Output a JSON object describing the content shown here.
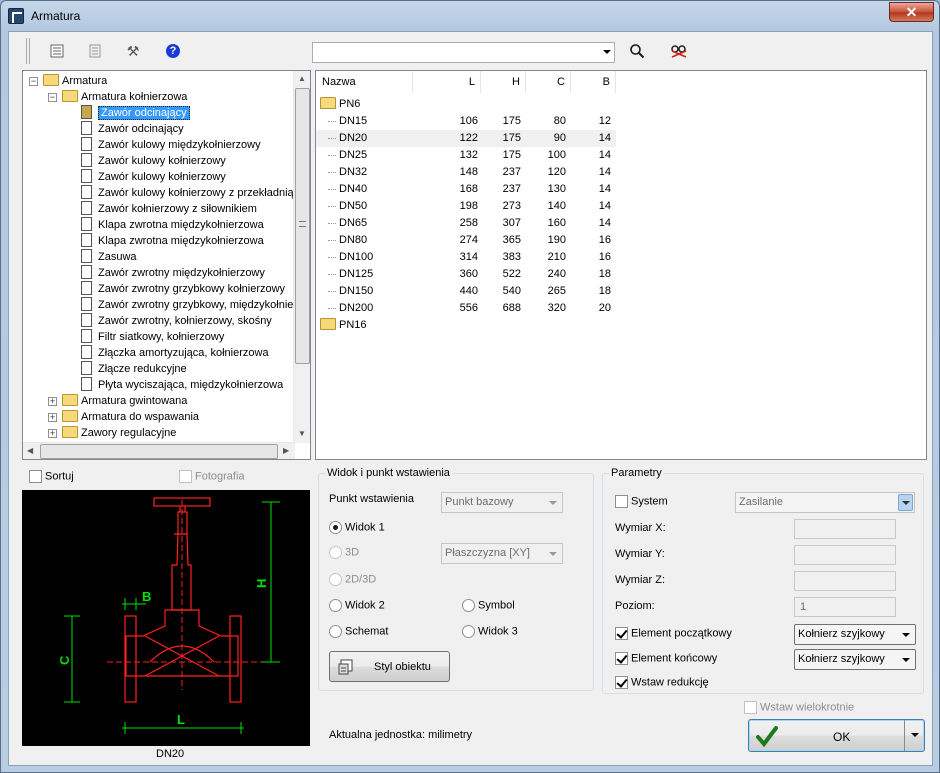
{
  "window": {
    "title": "Armatura"
  },
  "toolbar": {
    "search_value": "",
    "buttons": [
      "list-icon",
      "properties-icon",
      "tools-icon",
      "help-icon",
      "search-icon",
      "find-object-icon"
    ]
  },
  "tree": {
    "items": [
      {
        "level": 0,
        "type": "folder",
        "expander": "−",
        "label": "Armatura"
      },
      {
        "level": 1,
        "type": "folder",
        "expander": "−",
        "label": "Armatura kołnierzowa"
      },
      {
        "level": 2,
        "type": "doc",
        "label": "Zawór odcinający",
        "selected": true
      },
      {
        "level": 2,
        "type": "doc",
        "label": "Zawór odcinający"
      },
      {
        "level": 2,
        "type": "doc",
        "label": "Zawór kulowy międzykołnierzowy"
      },
      {
        "level": 2,
        "type": "doc",
        "label": "Zawór kulowy kołnierzowy"
      },
      {
        "level": 2,
        "type": "doc",
        "label": "Zawór kulowy kołnierzowy"
      },
      {
        "level": 2,
        "type": "doc",
        "label": "Zawór kulowy kołnierzowy z przekładnią"
      },
      {
        "level": 2,
        "type": "doc",
        "label": "Zawór kołnierzowy z siłownikiem"
      },
      {
        "level": 2,
        "type": "doc",
        "label": "Klapa zwrotna międzykołnierzowa"
      },
      {
        "level": 2,
        "type": "doc",
        "label": "Klapa zwrotna międzykołnierzowa"
      },
      {
        "level": 2,
        "type": "doc",
        "label": "Zasuwa"
      },
      {
        "level": 2,
        "type": "doc",
        "label": "Zawór zwrotny międzykołnierzowy"
      },
      {
        "level": 2,
        "type": "doc",
        "label": "Zawór zwrotny grzybkowy kołnierzowy"
      },
      {
        "level": 2,
        "type": "doc",
        "label": "Zawór zwrotny grzybkowy, międzykołnierzowy"
      },
      {
        "level": 2,
        "type": "doc",
        "label": "Zawór zwrotny, kołnierzowy, skośny"
      },
      {
        "level": 2,
        "type": "doc",
        "label": "Filtr siatkowy, kołnierzowy"
      },
      {
        "level": 2,
        "type": "doc",
        "label": "Złączka amortyzująca, kołnierzowa"
      },
      {
        "level": 2,
        "type": "doc",
        "label": "Złącze redukcyjne"
      },
      {
        "level": 2,
        "type": "doc",
        "label": "Płyta wyciszająca, międzykołnierzowa"
      },
      {
        "level": 1,
        "type": "folder",
        "expander": "+",
        "label": "Armatura gwintowana"
      },
      {
        "level": 1,
        "type": "folder",
        "expander": "+",
        "label": "Armatura do wspawania"
      },
      {
        "level": 1,
        "type": "folder",
        "expander": "+",
        "label": "Zawory regulacyjne"
      }
    ]
  },
  "table": {
    "headers": [
      "Nazwa",
      "L",
      "H",
      "C",
      "B"
    ],
    "groups": [
      {
        "name": "PN6",
        "rows": [
          [
            "DN15",
            "106",
            "175",
            "80",
            "12"
          ],
          [
            "DN20",
            "122",
            "175",
            "90",
            "14"
          ],
          [
            "DN25",
            "132",
            "175",
            "100",
            "14"
          ],
          [
            "DN32",
            "148",
            "237",
            "120",
            "14"
          ],
          [
            "DN40",
            "168",
            "237",
            "130",
            "14"
          ],
          [
            "DN50",
            "198",
            "273",
            "140",
            "14"
          ],
          [
            "DN65",
            "258",
            "307",
            "160",
            "14"
          ],
          [
            "DN80",
            "274",
            "365",
            "190",
            "16"
          ],
          [
            "DN100",
            "314",
            "383",
            "210",
            "16"
          ],
          [
            "DN125",
            "360",
            "522",
            "240",
            "18"
          ],
          [
            "DN150",
            "440",
            "540",
            "265",
            "18"
          ],
          [
            "DN200",
            "556",
            "688",
            "320",
            "20"
          ]
        ]
      },
      {
        "name": "PN16",
        "rows": []
      }
    ],
    "highlighted_row": "DN20"
  },
  "preview": {
    "sort_label": "Sortuj",
    "photo_label": "Fotografia",
    "caption": "DN20",
    "dim_labels": {
      "h": "H",
      "c": "C",
      "b": "B",
      "l": "L"
    }
  },
  "view": {
    "group_title": "Widok i punkt wstawienia",
    "insert_point_label": "Punkt wstawienia",
    "insert_point_value": "Punkt bazowy",
    "view1": "Widok 1",
    "view3d": "3D",
    "plane_value": "Płaszczyzna  [XY]",
    "view2d3d": "2D/3D",
    "view2": "Widok 2",
    "symbol": "Symbol",
    "schema": "Schemat",
    "view3": "Widok 3",
    "style_button": "Styl obiektu"
  },
  "params": {
    "group_title": "Parametry",
    "system_label": "System",
    "system_value": "Zasilanie",
    "dim_x": "Wymiar X:",
    "dim_y": "Wymiar Y:",
    "dim_z": "Wymiar Z:",
    "level": "Poziom:",
    "level_value": "1",
    "start_element": "Element początkowy",
    "start_value": "Kołnierz szyjkowy",
    "end_element": "Element końcowy",
    "end_value": "Kołnierz szyjkowy",
    "insert_reduction": "Wstaw redukcję"
  },
  "footer": {
    "unit_text": "Aktualna jednostka: milimetry",
    "multi_insert": "Wstaw wielokrotnie",
    "ok_label": "OK"
  },
  "colors": {
    "drawing_red": "#ff2020",
    "drawing_green": "#00e000",
    "selection": "#3399ff"
  }
}
